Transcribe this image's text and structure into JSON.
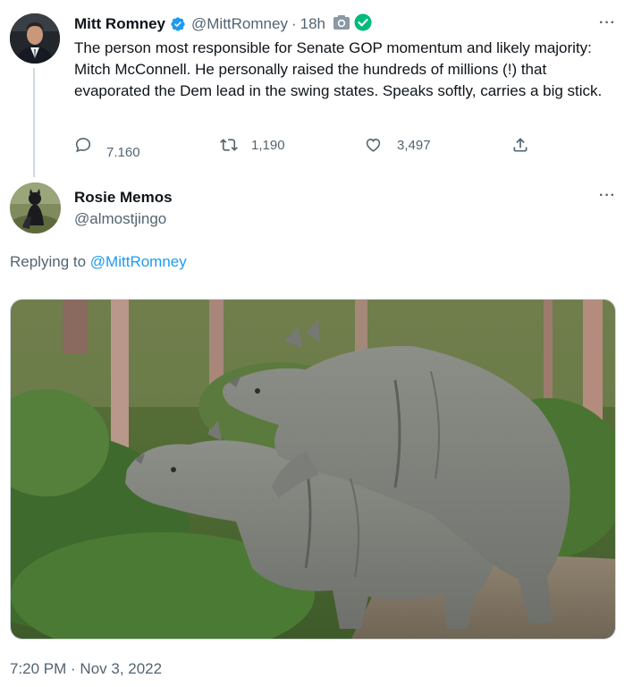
{
  "original_tweet": {
    "author_name": "Mitt Romney",
    "handle": "@MittRomney",
    "separator": "·",
    "time": "18h",
    "text": "The person most responsible for Senate GOP momentum and likely majority: Mitch McConnell. He personally raised the hundreds of millions (!) that evaporated the Dem lead in the swing states. Speaks softly, carries a big stick.",
    "replies": "7.160",
    "retweets": "1,190",
    "likes": "3,497",
    "more": "···"
  },
  "reply_tweet": {
    "author_name": "Rosie Memos",
    "handle": "@almostjingo",
    "replying_prefix": "Replying to",
    "replying_to": "@MittRomney",
    "more": "···",
    "timestamp": "7:20 PM · Nov 3, 2022"
  },
  "icons": {
    "verified": "verified-badge-icon",
    "camera": "camera-icon",
    "check": "check-circle-icon",
    "reply": "reply-icon",
    "retweet": "retweet-icon",
    "like": "heart-icon",
    "share": "share-icon"
  },
  "colors": {
    "accent": "#1d9bf0",
    "secondary_text": "#536471",
    "check_green": "#00ba7c"
  }
}
